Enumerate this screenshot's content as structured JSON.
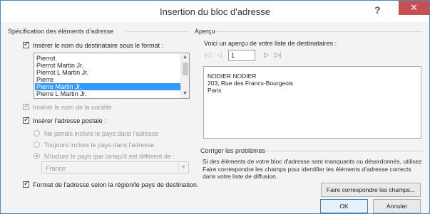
{
  "window": {
    "title": "Insertion du bloc d'adresse",
    "help_label": "?",
    "close_label": "✕"
  },
  "left": {
    "section_title": "Spécification des éléments d'adresse",
    "insert_name_label": "Insérer le nom du destinataire sous le format :",
    "name_formats": [
      "Pierrot",
      "Pierrot Martin Jr.",
      "Pierrot L Martin Jr.",
      "Pierre",
      "Pierre Martin Jr.",
      "Pierre L Martin Jr."
    ],
    "selected_format": "Pierre Martin Jr.",
    "insert_company_label": "Insérer le nom de la société",
    "insert_postal_label": "Insérer l'adresse postale :",
    "country_options": [
      "Ne jamais inclure le pays dans l'adresse",
      "Toujours inclure le pays dans l'adresse",
      "N'inclure le pays que lorsqu'il est différent de :"
    ],
    "selected_country_option": "N'inclure le pays que lorsqu'il est différent de :",
    "country_value": "France",
    "format_region_label": "Format de l'adresse selon la région/le pays de destination."
  },
  "right": {
    "section_title": "Aperçu",
    "preview_caption": "Voici un aperçu de votre liste de destinataires :",
    "page_number": "1",
    "preview_lines": [
      "NODIER NODIER",
      "203, Rue des Francs-Bourgeois",
      "Paris"
    ],
    "fix_title": "Corriger les problèmes",
    "fix_text": "Si des éléments de votre bloc d'adresse sont manquants ou désordonnés, utilisez Faire correspondre les champs pour identifier les éléments d'adresse corrects dans votre liste de diffusion.",
    "match_fields_button": "Faire correspondre les champs..."
  },
  "footer": {
    "ok_label": "OK",
    "cancel_label": "Annuler"
  }
}
